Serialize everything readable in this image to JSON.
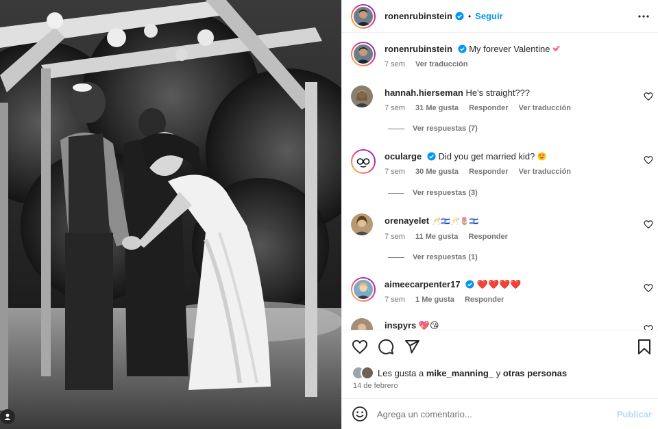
{
  "post": {
    "author": "ronenrubinstein",
    "follow_label": "Seguir",
    "dot": "•",
    "caption": {
      "username": "ronenrubinstein",
      "text": "My forever Valentine",
      "emoji": "two-hearts",
      "age": "7 sem",
      "translate": "Ver traducción"
    }
  },
  "comments": [
    {
      "username": "hannah.hierseman",
      "verified": false,
      "text": "He's straight???",
      "age": "7 sem",
      "likes": "31 Me gusta",
      "reply": "Responder",
      "translate": "Ver traducción",
      "replies": "Ver respuestas (7)"
    },
    {
      "username": "ocularge",
      "verified": true,
      "text": "Did you get married kid?",
      "emoji": "heart-eyes",
      "age": "7 sem",
      "likes": "30 Me gusta",
      "reply": "Responder",
      "translate": "Ver traducción",
      "replies": "Ver respuestas (3)"
    },
    {
      "username": "orenayelet",
      "verified": false,
      "text": "🥂🇮🇱🥂🌷🇮🇱",
      "age": "7 sem",
      "likes": "11 Me gusta",
      "reply": "Responder",
      "replies": "Ver respuestas (1)"
    },
    {
      "username": "aimeecarpenter17",
      "verified": true,
      "text": "❤️❤️❤️❤️",
      "age": "7 sem",
      "likes": "1 Me gusta",
      "reply": "Responder"
    },
    {
      "username": "inspyrs",
      "verified": false,
      "text": "💖😘"
    }
  ],
  "actions": {
    "liked_by_prefix": "Les gusta a",
    "liked_by_user": "mike_manning_",
    "liked_by_join": "y",
    "liked_by_others": "otras personas",
    "date": "14 de febrero"
  },
  "composer": {
    "placeholder": "Agrega un comentario...",
    "publish_label": "Publicar"
  },
  "colors": {
    "accent": "#0095f6",
    "publish_disabled": "#b3dbff",
    "muted": "#737373",
    "text": "#262626",
    "heart": "#ed4956"
  }
}
